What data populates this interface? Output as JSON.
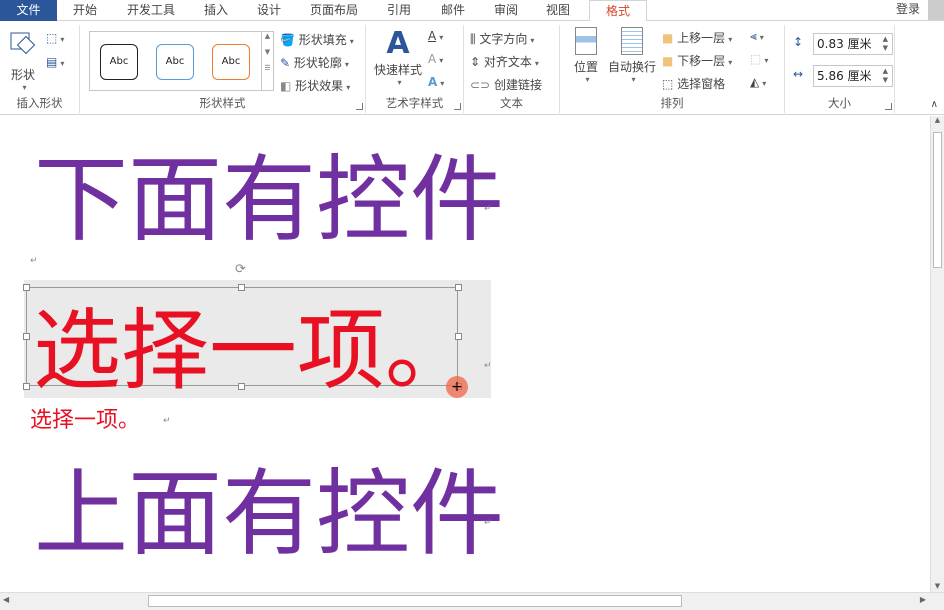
{
  "tabs": [
    "文件",
    "开始",
    "开发工具",
    "插入",
    "设计",
    "页面布局",
    "引用",
    "邮件",
    "审阅",
    "视图",
    "格式"
  ],
  "active_tab": "格式",
  "login": "登录",
  "groups": {
    "insert_shape": {
      "label": "插入形状",
      "shape_btn": "形状"
    },
    "shape_styles": {
      "label": "形状样式",
      "abc": [
        "Abc",
        "Abc",
        "Abc"
      ],
      "fill": "形状填充",
      "outline": "形状轮廓",
      "effect": "形状效果"
    },
    "wordart": {
      "label": "艺术字样式",
      "quick": "快速样式"
    },
    "text": {
      "label": "文本",
      "direction": "文字方向",
      "align": "对齐文本",
      "link": "创建链接"
    },
    "arrange": {
      "label": "排列",
      "position": "位置",
      "wrap": "自动换行",
      "forward": "上移一层",
      "backward": "下移一层",
      "pane": "选择窗格"
    },
    "size": {
      "label": "大小",
      "height": "0.83 厘米",
      "width": "5.86 厘米"
    }
  },
  "document": {
    "line1": "下面有控件",
    "textbox": "选择一项。",
    "small": "选择一项。",
    "line2": "上面有控件",
    "para_mark": "↵"
  },
  "colors": {
    "purple": "#7030a0",
    "red": "#e81123",
    "file_tab": "#2b579a",
    "accent": "#d24726"
  }
}
